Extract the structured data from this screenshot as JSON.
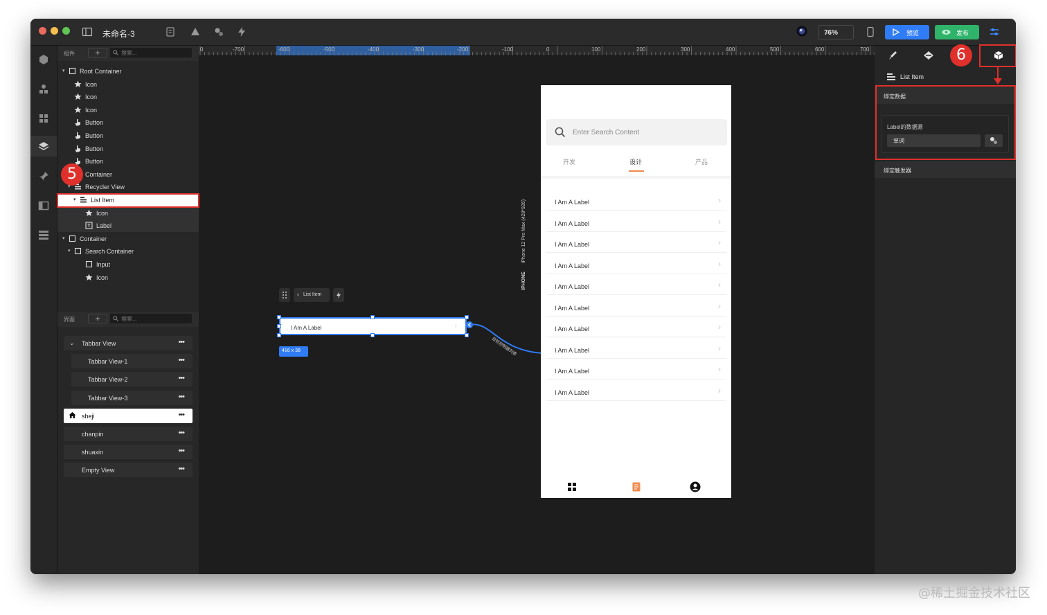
{
  "window": {
    "title": "未命名-3",
    "zoom": "76%",
    "preview_label": "预览",
    "publish_label": "发布"
  },
  "components_panel": {
    "header_label": "组件",
    "search_placeholder": "搜索...",
    "tree": [
      {
        "label": "Root Container",
        "icon": "square-icon"
      },
      {
        "label": "Icon",
        "icon": "star-icon"
      },
      {
        "label": "Icon",
        "icon": "star-icon"
      },
      {
        "label": "Icon",
        "icon": "star-icon"
      },
      {
        "label": "Button",
        "icon": "pointer-hand-icon"
      },
      {
        "label": "Button",
        "icon": "pointer-hand-icon"
      },
      {
        "label": "Button",
        "icon": "pointer-hand-icon"
      },
      {
        "label": "Button",
        "icon": "pointer-hand-icon"
      },
      {
        "label": "Container",
        "icon": "square-icon"
      },
      {
        "label": "Recycler View",
        "icon": "list-icon"
      },
      {
        "label": "List Item",
        "icon": "list-icon"
      },
      {
        "label": "Icon",
        "icon": "star-icon"
      },
      {
        "label": "Label",
        "icon": "text-box-icon"
      },
      {
        "label": "Container",
        "icon": "square-icon"
      },
      {
        "label": "Search Container",
        "icon": "square-icon"
      },
      {
        "label": "Input",
        "icon": "square-icon"
      },
      {
        "label": "Icon",
        "icon": "star-icon"
      }
    ]
  },
  "pages_panel": {
    "header_label": "界面",
    "search_placeholder": "搜索...",
    "items": [
      {
        "label": "Tabbar View"
      },
      {
        "label": "Tabbar View-1"
      },
      {
        "label": "Tabbar View-2"
      },
      {
        "label": "Tabbar View-3"
      },
      {
        "label": "sheji"
      },
      {
        "label": "chanpin"
      },
      {
        "label": "shuaxin"
      },
      {
        "label": "Empty View"
      }
    ]
  },
  "ruler": {
    "labels": [
      "0",
      "-700",
      "-600",
      "-500",
      "-400",
      "-300",
      "-200",
      "-100",
      "0",
      "100",
      "200",
      "300",
      "400",
      "500",
      "600",
      "700"
    ]
  },
  "canvas": {
    "selected_toolbar_label": "List Item",
    "selected_item_label": "I Am A Label",
    "size_tag": "416 x 38",
    "connector_label": "目标控制器列表",
    "device_name": "IPHONE",
    "device_model": "iPhone 12 Pro Max (428*926)"
  },
  "phone": {
    "search_placeholder": "Enter Search Content",
    "tabs": [
      "开发",
      "设计",
      "产品"
    ],
    "list_items": [
      "I Am A Label",
      "I Am A Label",
      "I Am A Label",
      "I Am A Label",
      "I Am A Label",
      "I Am A Label",
      "I Am A Label",
      "I Am A Label",
      "I Am A Label",
      "I Am A Label"
    ],
    "nav_icons": [
      "dashboard-icon",
      "document-icon",
      "account-icon"
    ],
    "accent_color": "#f08a4b"
  },
  "inspector": {
    "title": "List Item",
    "bind_data_label": "绑定数据",
    "label_source_label": "Label的数据源",
    "source_value": "单词",
    "bind_trigger_label": "绑定触发器"
  },
  "annotations": {
    "badge_5": "5",
    "badge_6": "6"
  },
  "watermark": "@稀土掘金技术社区"
}
